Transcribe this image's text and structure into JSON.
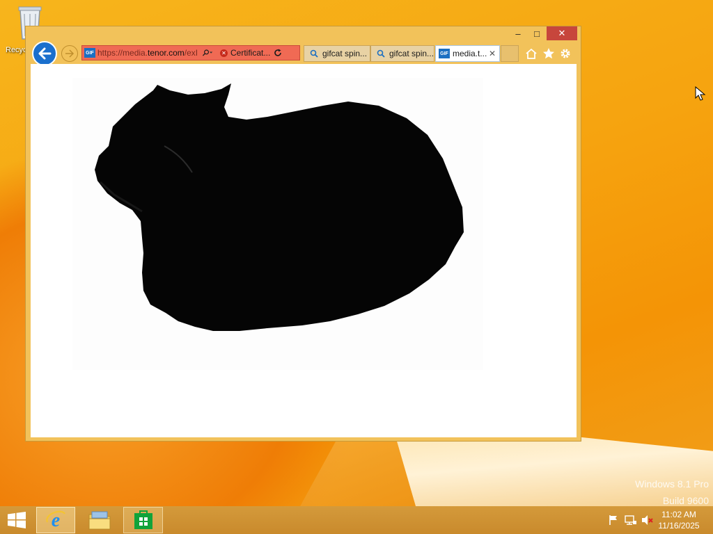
{
  "desktop": {
    "recycle_bin_label": "Recyc",
    "watermark_line1": "Windows 8.1 Pro",
    "watermark_line2": "Build 9600"
  },
  "browser": {
    "address": {
      "url_prefix": "https://media.",
      "url_domain": "tenor.com",
      "url_suffix": "/exI",
      "certificate_label": "Certificat..."
    },
    "tabs": [
      {
        "label": "gifcat spin...",
        "icon": "search-icon",
        "active": false
      },
      {
        "label": "gifcat spin...",
        "icon": "search-icon",
        "active": false
      },
      {
        "label": "media.t...",
        "icon": "gif-icon",
        "active": true
      }
    ],
    "favicon_text": "GIF",
    "window_controls": {
      "minimize": "–",
      "maximize": "□",
      "close": "✕"
    },
    "toolbar_icons": [
      "home-icon",
      "favorites-star-icon",
      "settings-gear-icon"
    ]
  },
  "taskbar": {
    "apps": [
      "internet-explorer-icon",
      "file-explorer-icon",
      "store-icon"
    ],
    "tray_icons": [
      "action-center-flag-icon",
      "network-icon",
      "volume-muted-icon"
    ],
    "time": "11:02 AM",
    "date": "11/16/2025"
  },
  "colors": {
    "window_frame": "#f2c25a",
    "address_bar_error": "#f06a54",
    "close_button": "#c7463c",
    "back_button": "#1a6fcd"
  }
}
